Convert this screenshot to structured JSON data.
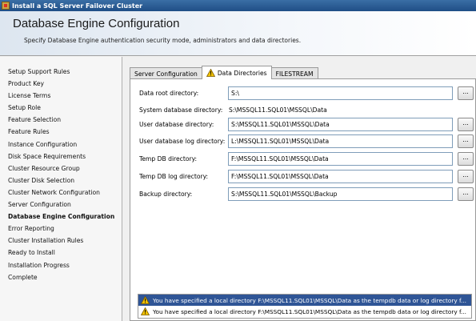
{
  "window": {
    "title": "Install a SQL Server Failover Cluster"
  },
  "header": {
    "title": "Database Engine Configuration",
    "subtitle": "Specify Database Engine authentication security mode, administrators and data directories."
  },
  "sidebar": {
    "items": [
      {
        "label": "Setup Support Rules"
      },
      {
        "label": "Product Key"
      },
      {
        "label": "License Terms"
      },
      {
        "label": "Setup Role"
      },
      {
        "label": "Feature Selection"
      },
      {
        "label": "Feature Rules"
      },
      {
        "label": "Instance Configuration"
      },
      {
        "label": "Disk Space Requirements"
      },
      {
        "label": "Cluster Resource Group"
      },
      {
        "label": "Cluster Disk Selection"
      },
      {
        "label": "Cluster Network Configuration"
      },
      {
        "label": "Server Configuration"
      },
      {
        "label": "Database Engine Configuration"
      },
      {
        "label": "Error Reporting"
      },
      {
        "label": "Cluster Installation Rules"
      },
      {
        "label": "Ready to Install"
      },
      {
        "label": "Installation Progress"
      },
      {
        "label": "Complete"
      }
    ],
    "active_index": 12
  },
  "tabs": [
    {
      "label": "Server Configuration"
    },
    {
      "label": "Data Directories",
      "icon": "warning-icon"
    },
    {
      "label": "FILESTREAM"
    }
  ],
  "fields": {
    "data_root": {
      "label": "Data root directory:",
      "value": "S:\\",
      "browse": "..."
    },
    "system_db": {
      "label": "System database directory:",
      "value": "S:\\MSSQL11.SQL01\\MSSQL\\Data"
    },
    "user_db": {
      "label": "User database directory:",
      "value": "S:\\MSSQL11.SQL01\\MSSQL\\Data",
      "browse": "..."
    },
    "user_db_log": {
      "label": "User database log directory:",
      "value": "L:\\MSSQL11.SQL01\\MSSQL\\Data",
      "browse": "..."
    },
    "temp_db": {
      "label": "Temp DB directory:",
      "value": "F:\\MSSQL11.SQL01\\MSSQL\\Data",
      "browse": "..."
    },
    "temp_db_log": {
      "label": "Temp DB log directory:",
      "value": "F:\\MSSQL11.SQL01\\MSSQL\\Data",
      "browse": "..."
    },
    "backup": {
      "label": "Backup directory:",
      "value": "S:\\MSSQL11.SQL01\\MSSQL\\Backup",
      "browse": "..."
    }
  },
  "messages": [
    {
      "text": "You have specified a local directory F:\\MSSQL11.SQL01\\MSSQL\\Data as the tempdb data or log directory f...",
      "icon": "warning-icon",
      "selected": true
    },
    {
      "text": "You have specified a local directory F:\\MSSQL11.SQL01\\MSSQL\\Data as the tempdb data or log directory f...",
      "icon": "warning-icon",
      "selected": false
    }
  ],
  "colors": {
    "title_bar": "#1f4e86",
    "selection": "#2f5596",
    "warning": "#f2c200"
  }
}
